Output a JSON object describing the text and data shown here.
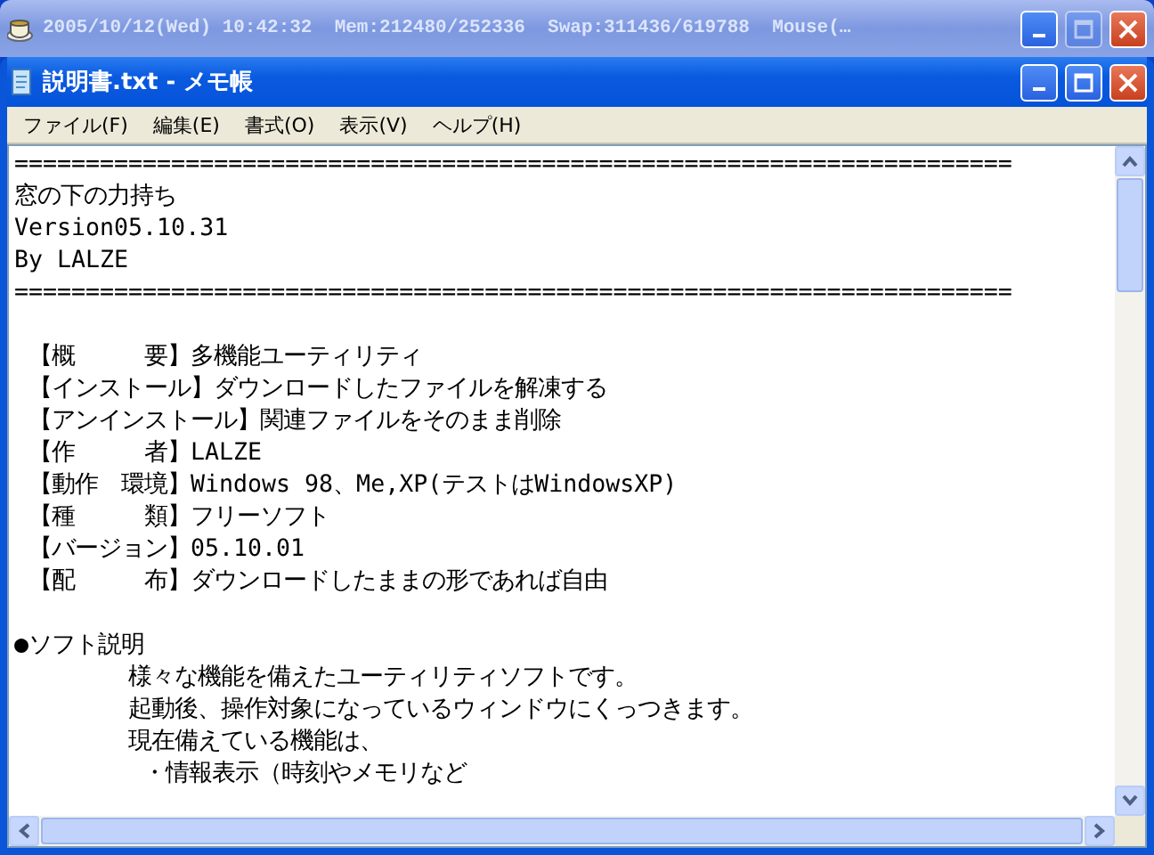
{
  "status_window": {
    "title": "2005/10/12(Wed) 10:42:32  Mem:212480/252336  Swap:311436/619788  Mouse(…",
    "buttons": [
      {
        "kind": "minimize",
        "disabled": false
      },
      {
        "kind": "maximize",
        "disabled": true
      },
      {
        "kind": "close",
        "disabled": false
      }
    ]
  },
  "notepad": {
    "title": "説明書.txt - メモ帳",
    "menu": [
      "ファイル(F)",
      "編集(E)",
      "書式(O)",
      "表示(V)",
      "ヘルプ(H)"
    ],
    "paragraphs": [
      [
        "======================================================================",
        "窓の下の力持ち",
        "Version05.10.31",
        "By LALZE",
        "======================================================================"
      ],
      [
        " 【概　　　要】多機能ユーティリティ",
        " 【インストール】ダウンロードしたファイルを解凍する",
        " 【アンインストール】関連ファイルをそのまま削除",
        " 【作　　　者】LALZE",
        " 【動作　環境】Windows 98、Me,XP(テストはWindowsXP)",
        " 【種　　　類】フリーソフト",
        " 【バージョン】05.10.01",
        " 【配　　　布】ダウンロードしたままの形であれば自由"
      ],
      [
        "●ソフト説明",
        "        様々な機能を備えたユーティリティソフトです。",
        "        起動後、操作対象になっているウィンドウにくっつきます。",
        "        現在備えている機能は、",
        "         ・情報表示（時刻やメモリなど"
      ]
    ]
  }
}
